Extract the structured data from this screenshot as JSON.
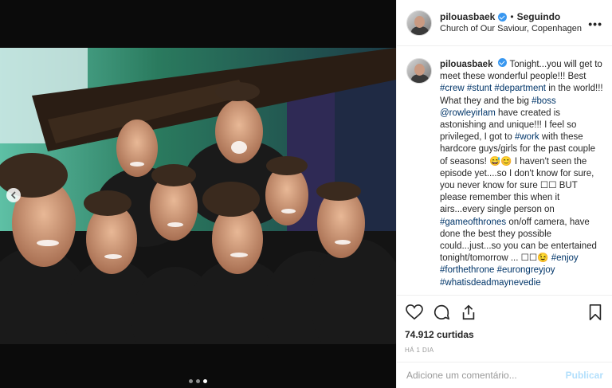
{
  "post": {
    "header": {
      "username": "pilouasbaek",
      "separator": "•",
      "following_label": "Seguindo",
      "location": "Church of Our Saviour, Copenhagen",
      "more_icon": "more-horizontal-icon"
    },
    "caption": {
      "username": "pilouasbaek",
      "segments": [
        {
          "t": "Tonight...you will get to meet these wonderful people!!! Best ",
          "link": false
        },
        {
          "t": "#crew",
          "link": true
        },
        {
          "t": " ",
          "link": false
        },
        {
          "t": "#stunt",
          "link": true
        },
        {
          "t": " ",
          "link": false
        },
        {
          "t": "#department",
          "link": true
        },
        {
          "t": " in the world!!! What they and the big ",
          "link": false
        },
        {
          "t": "#boss",
          "link": true
        },
        {
          "t": " ",
          "link": false
        },
        {
          "t": "@rowleyirlam",
          "link": true
        },
        {
          "t": " have created is astonishing and unique!!! I feel so privileged, I got to ",
          "link": false
        },
        {
          "t": "#work",
          "link": true
        },
        {
          "t": " with these hardcore guys/girls for the past couple of seasons! 😅😊 I haven't seen the episode yet....so I don't know for sure, you never know for sure ☐☐ BUT please remember this when it airs...every single person on ",
          "link": false
        },
        {
          "t": "#gameofthrones",
          "link": true
        },
        {
          "t": " on/off camera, have done the best they possible could...just...so you can be entertained tonight/tomorrow ... ☐☐😉 ",
          "link": false
        },
        {
          "t": "#enjoy",
          "link": true
        },
        {
          "t": " ",
          "link": false
        },
        {
          "t": "#forthethrone",
          "link": true
        },
        {
          "t": " ",
          "link": false
        },
        {
          "t": "#eurongreyjoy",
          "link": true
        },
        {
          "t": " ",
          "link": false
        },
        {
          "t": "#whatisdeadmaynevedie",
          "link": true
        }
      ]
    },
    "actions": {
      "like_icon": "heart-icon",
      "comment_icon": "comment-icon",
      "share_icon": "share-icon",
      "save_icon": "bookmark-icon"
    },
    "likes": "74.912 curtidas",
    "time": "HÁ 1 DIA",
    "add_comment": {
      "placeholder": "Adicione um comentário...",
      "publish_label": "Publicar"
    },
    "carousel": {
      "count": 3,
      "active": 2,
      "prev_icon": "chevron-left-icon"
    }
  }
}
